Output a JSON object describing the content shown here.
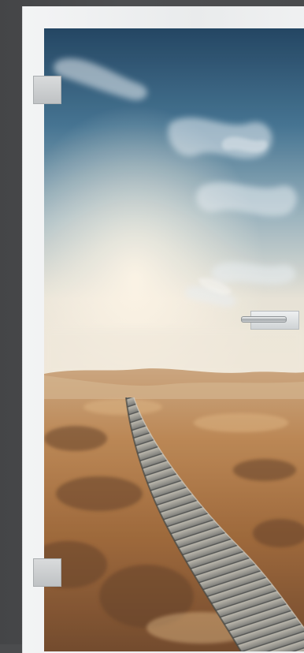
{
  "scene": {
    "subject": "glass-door-with-photo-print",
    "photo_subject": "boardwalk-through-grass-dunes-under-sky",
    "palette": {
      "wall": "#4b4c4e",
      "frame": "#eceeef",
      "sky_top": "#1f4563",
      "sky_mid": "#5f8fa9",
      "horizon_haze": "#e9e3d7",
      "grass": "#b07a45",
      "grass_dark": "#6a4426",
      "boardwalk": "#8b8c88",
      "hardware": "#c9cccf"
    }
  }
}
